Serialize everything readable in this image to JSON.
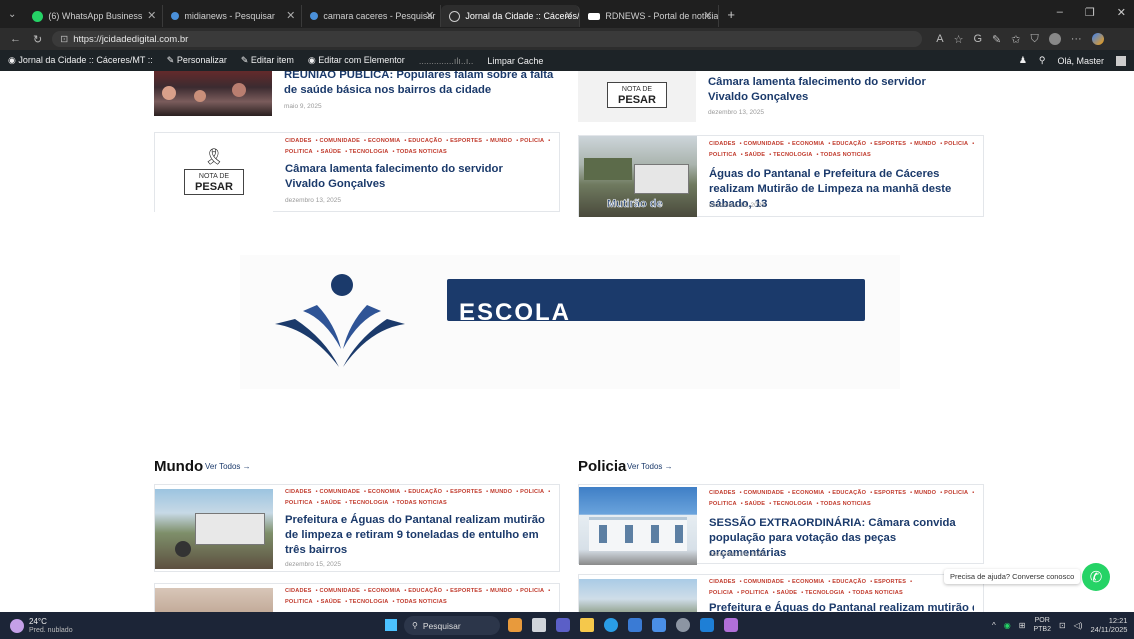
{
  "browser": {
    "tabs": [
      {
        "label": "(6) WhatsApp Business",
        "icon": "whatsapp-icon",
        "color": "#25d366"
      },
      {
        "label": "midianews - Pesquisar",
        "icon": "search-icon",
        "color": "#4a90d9"
      },
      {
        "label": "camara caceres - Pesquisar",
        "icon": "search-icon",
        "color": "#4a90d9"
      },
      {
        "label": "Jornal da Cidade :: Cáceres/MT :: ...",
        "icon": "globe-icon",
        "color": "#cccccc"
      },
      {
        "label": "RDNEWS - Portal de notícias de M",
        "icon": "rd-icon",
        "color": "#ffffff"
      }
    ],
    "url": "https://jcidadedigital.com.br"
  },
  "wp_admin": {
    "site": "Jornal da Cidade :: Cáceres/MT ::",
    "customize": "Personalizar",
    "edit_item": "Editar item",
    "edit_elementor": "Editar com Elementor",
    "clear_cache": "Limpar Cache",
    "greeting": "Olá, Master"
  },
  "categories": [
    "CIDADES",
    "COMUNIDADE",
    "ECONOMIA",
    "EDUCAÇÃO",
    "ESPORTES",
    "MUNDO",
    "POLICIA",
    "POLITICA",
    "SAÚDE",
    "TECNOLOGIA",
    "TODAS NOTICIAS"
  ],
  "top_left": [
    {
      "title": "REUNIÃO PÚBLICA: Populares falam sobre a falta de saúde básica nos bairros da cidade",
      "date": "maio 9, 2025"
    },
    {
      "title": "Câmara lamenta falecimento do servidor Vivaldo Gonçalves",
      "date": "dezembro 13, 2025",
      "thumb_top": "NOTA DE",
      "thumb_bottom": "PESAR"
    }
  ],
  "top_right": [
    {
      "title": "Câmara lamenta falecimento do servidor Vivaldo Gonçalves",
      "date": "dezembro 13, 2025",
      "thumb_top": "NOTA DE",
      "thumb_bottom": "PESAR"
    },
    {
      "title": "Águas do Pantanal e Prefeitura de Cáceres realizam Mutirão de Limpeza na manhã deste sábado, 13",
      "date": "dezembro 13, 2025",
      "thumb_caption": "Mutirão de"
    }
  ],
  "banner": {
    "text": "ESCOLA"
  },
  "mundo": {
    "title": "Mundo",
    "see_all": "Ver Todos →",
    "items": [
      {
        "title": "Prefeitura e Águas do Pantanal realizam mutirão de limpeza e retiram 9 toneladas de entulho em três bairros",
        "date": "dezembro 15, 2025"
      }
    ]
  },
  "policia": {
    "title": "Policia",
    "see_all": "Ver Todos →",
    "items": [
      {
        "title": "SESSÃO EXTRAORDINÁRIA: Câmara convida população para votação das peças orçamentárias",
        "date": "dezembro 16, 2025"
      },
      {
        "title": "Prefeitura e Águas do Pantanal realizam mutirão de"
      }
    ]
  },
  "whatsapp_help": {
    "prefix": "Precisa de ajuda?",
    "link": "Converse conosco"
  },
  "taskbar": {
    "weather_temp": "24°C",
    "weather_desc": "Pred. nublado",
    "search": "Pesquisar",
    "lang": "POR",
    "layout": "PTB2",
    "time": "12:21",
    "date": "24/11/2025"
  }
}
